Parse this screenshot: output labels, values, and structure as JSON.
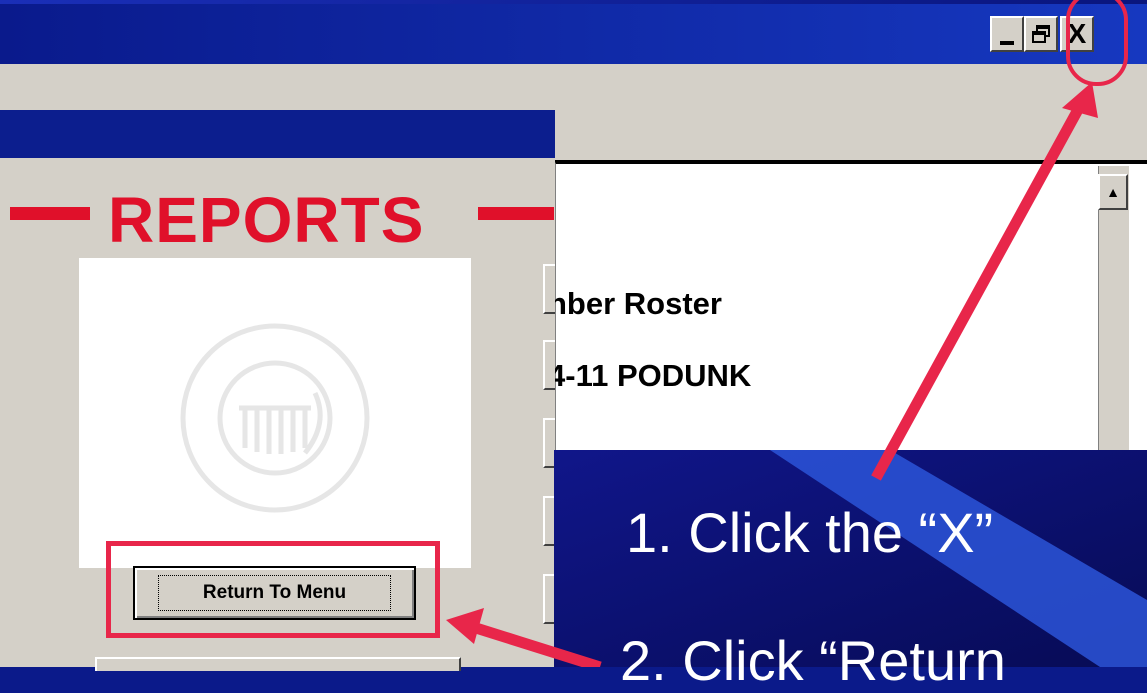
{
  "window": {
    "caption_buttons": {
      "minimize_icon": "minimize-icon",
      "restore_icon": "restore-icon",
      "close_label": "X"
    }
  },
  "form": {
    "heading": "REPORTS",
    "logo": "uscg-auxiliary-seal",
    "return_button_label": "Return To Menu"
  },
  "report_preview": {
    "title": "nber Roster",
    "unit": "4-11 PODUNK"
  },
  "instructions": {
    "step1": "1. Click the “X”",
    "step2": "2. Click “Return"
  },
  "colors": {
    "highlight": "#e8264a",
    "heading_red": "#e0102a",
    "titlebar_blue": "#0c1e8e",
    "window_gray": "#d4d0c8"
  }
}
